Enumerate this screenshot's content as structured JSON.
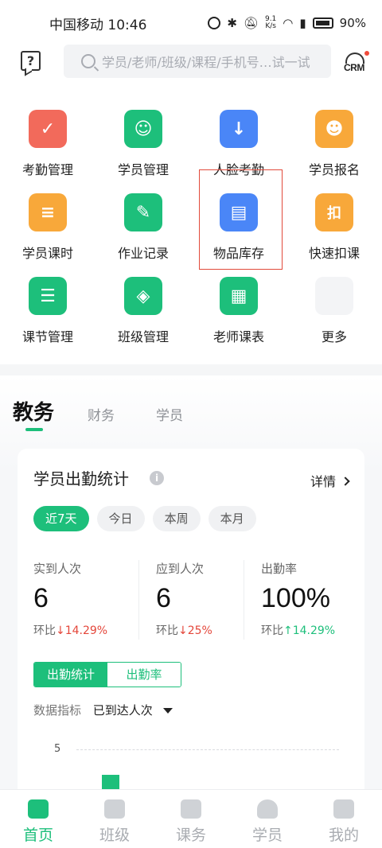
{
  "status_bar": {
    "carrier_time": "中国移动 10:46",
    "net_speed_top": "9.1",
    "net_speed_bottom": "K/s",
    "battery": "90%"
  },
  "header": {
    "search_placeholder": "学员/老师/班级/课程/手机号…试一试",
    "crm_label": "CRM"
  },
  "grid": {
    "items": [
      {
        "label": "考勤管理",
        "icon": "clipboard-check-icon",
        "color": "#f26a5b"
      },
      {
        "label": "学员管理",
        "icon": "student-icon",
        "color": "#1dbf7b"
      },
      {
        "label": "人脸考勤",
        "icon": "face-check-icon",
        "color": "#4a86f7"
      },
      {
        "label": "学员报名",
        "icon": "student-enroll-icon",
        "color": "#f8a83a"
      },
      {
        "label": "学员课时",
        "icon": "document-icon",
        "color": "#f8a83a"
      },
      {
        "label": "作业记录",
        "icon": "edit-note-icon",
        "color": "#1dbf7b"
      },
      {
        "label": "物品库存",
        "icon": "archive-box-icon",
        "color": "#4a86f7"
      },
      {
        "label": "快速扣课",
        "icon": "deduct-icon",
        "color": "#f8a83a",
        "glyph": "扣"
      },
      {
        "label": "课节管理",
        "icon": "clipboard-list-icon",
        "color": "#1dbf7b"
      },
      {
        "label": "班级管理",
        "icon": "cube-icon",
        "color": "#1dbf7b"
      },
      {
        "label": "老师课表",
        "icon": "calendar-icon",
        "color": "#1dbf7b"
      },
      {
        "label": "更多",
        "icon": "more-grid-icon",
        "color": "#f3f4f6"
      }
    ]
  },
  "tabs": {
    "active": "教务",
    "finance": "财务",
    "student": "学员"
  },
  "card": {
    "title": "学员出勤统计",
    "detail_label": "详情",
    "pills": [
      "近7天",
      "今日",
      "本周",
      "本月"
    ],
    "stats": [
      {
        "label": "实到人次",
        "value": "6",
        "compare_label": "环比",
        "compare_value": "↓14.29%",
        "trend": "down"
      },
      {
        "label": "应到人次",
        "value": "6",
        "compare_label": "环比",
        "compare_value": "↓25%",
        "trend": "down"
      },
      {
        "label": "出勤率",
        "value": "100%",
        "compare_label": "环比",
        "compare_value": "↑14.29%",
        "trend": "up"
      }
    ],
    "segment": [
      "出勤统计",
      "出勤率"
    ],
    "metric_label": "数据指标",
    "metric_value": "已到达人次",
    "chart_tick": "5"
  },
  "bottom_nav": [
    {
      "label": "首页",
      "icon": "home-chart-icon",
      "active": true
    },
    {
      "label": "班级",
      "icon": "class-cube-icon",
      "active": false
    },
    {
      "label": "课务",
      "icon": "course-book-icon",
      "active": false
    },
    {
      "label": "学员",
      "icon": "student-icon",
      "active": false
    },
    {
      "label": "我的",
      "icon": "profile-house-icon",
      "active": false
    }
  ]
}
